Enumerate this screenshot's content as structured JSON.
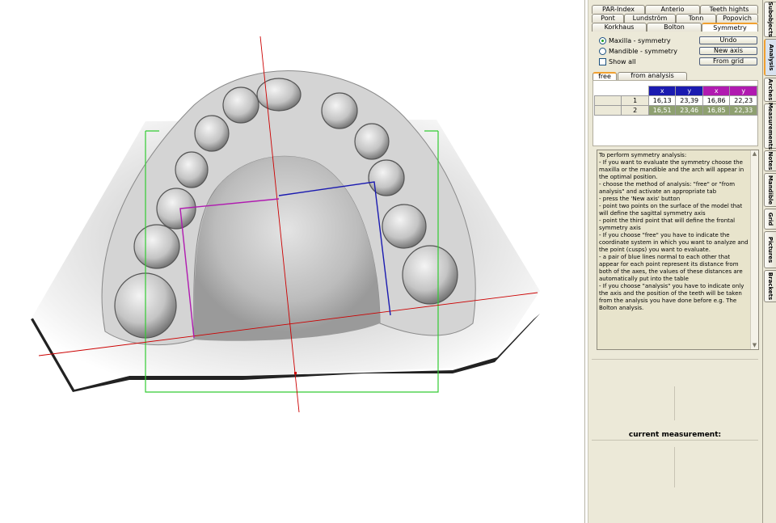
{
  "top_tabs": {
    "row1": [
      "PAR-Index",
      "Anterio",
      "Teeth hights"
    ],
    "row2": [
      "Pont",
      "Lundström",
      "Tonn",
      "Popovich"
    ],
    "row3": [
      "Korkhaus",
      "Bolton",
      "Symmetry"
    ]
  },
  "options": {
    "maxilla": "Maxilla - symmetry",
    "mandible": "Mandible - symmetry",
    "show_all": "Show all"
  },
  "buttons": {
    "undo": "Undo",
    "new_axis": "New axis",
    "from_grid": "From grid"
  },
  "subtabs": [
    "free",
    "from analysis"
  ],
  "table": {
    "headers": [
      "x",
      "y",
      "x",
      "y"
    ],
    "header_colors": [
      "#1a1ab0",
      "#1a1ab0",
      "#b01ab0",
      "#b01ab0"
    ],
    "rows": [
      {
        "index": "1",
        "cells": [
          "16,13",
          "23,39",
          "16,86",
          "22,23"
        ]
      },
      {
        "index": "2",
        "cells": [
          "16,51",
          "23,46",
          "16,85",
          "22,33"
        ]
      }
    ]
  },
  "info_text": "To perform symmetry analysis:\n- If you want to evaluate the symmetry choose the maxilla or the mandible and the arch will appear in the optimal position.\n- choose the method of analysis: \"free\" or \"from analysis\" and activate an appropriate tab\n- press the 'New axis' button\n- point two points on the surface of the model that will define the sagittal symmetry axis\n- point the third point that will define the frontal symmetry axis\n- If you choose \"free\" you have to indicate the coordinate system in which you want to analyze and the point (cusps) you want to evaluate.\n- a pair of blue lines normal to each other that appear for each point represent its distance from both of the axes, the values of these distances are automatically put into the table\n- If you choose \"analysis\" you have to indicate only the axis and the position of the teeth will be taken from the analysis you have done before e.g. The Bolton analysis.",
  "current_measurement_label": "current measurement:",
  "vertical_tabs": [
    "Subobjects",
    "Analysis",
    "Arches",
    "Measurements",
    "Notes",
    "Mandible",
    "Grid",
    "Pictures",
    "Brackets"
  ],
  "colors": {
    "grid_green": "#33cc33",
    "axis_red": "#cc0000",
    "line_blue": "#1a1ab0",
    "line_magenta": "#b01ab0",
    "row2_bg": "#8ea070"
  }
}
